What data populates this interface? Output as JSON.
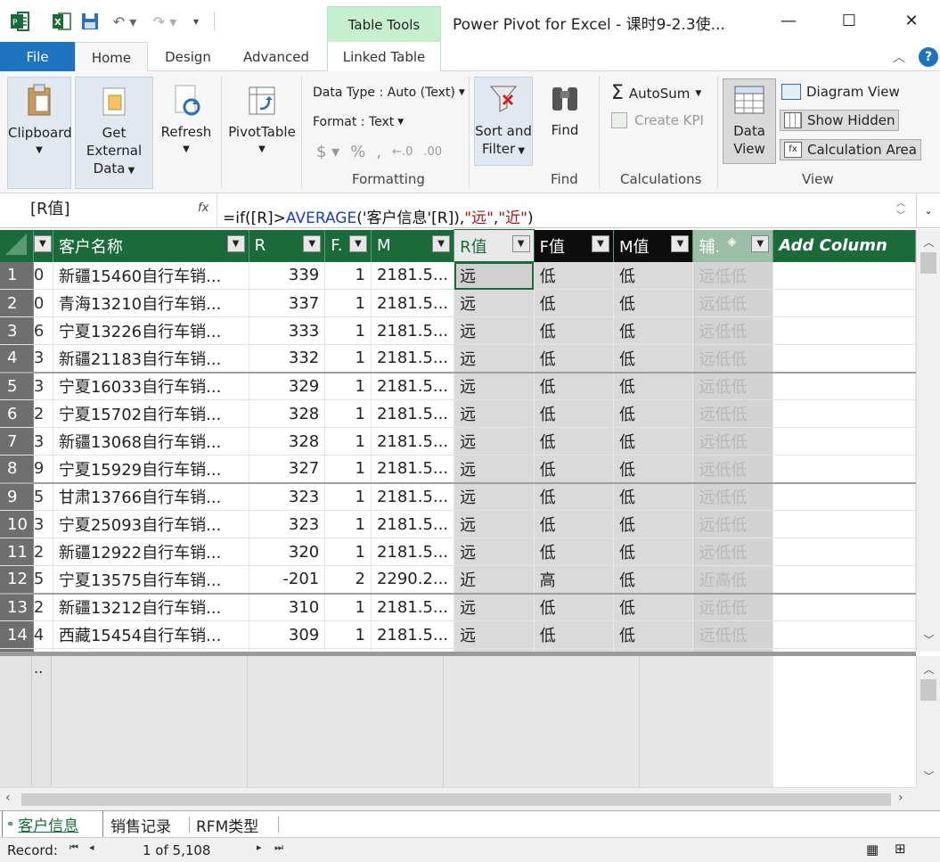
{
  "titlebar": {
    "table_tools": "Table Tools",
    "title": "Power Pivot for Excel - 课时9-2.3使..."
  },
  "tabs": [
    "File",
    "Home",
    "Design",
    "Advanced",
    "Linked Table"
  ],
  "ribbon": {
    "clipboard": "Clipboard",
    "get_external_data_1": "Get External",
    "get_external_data_2": "Data",
    "refresh": "Refresh",
    "pivottable": "PivotTable",
    "data_type": "Data Type : Auto (Text)",
    "format": "Format : Text",
    "formatting_label": "Formatting",
    "sort_filter_1": "Sort and",
    "sort_filter_2": "Filter",
    "find": "Find",
    "find_label": "Find",
    "autosum": "AutoSum",
    "create_kpi": "Create KPI",
    "calculations_label": "Calculations",
    "data_view_1": "Data",
    "data_view_2": "View",
    "diagram_view": "Diagram View",
    "show_hidden": "Show Hidden",
    "calculation_area": "Calculation Area",
    "view_label": "View"
  },
  "formula_bar": {
    "name_box": "[R值]",
    "fx": "fx",
    "formula_parts": [
      "=if([R]>",
      "AVERAGE",
      "('客户信息'[R]),",
      "\"远\"",
      ",",
      "\"近\"",
      ")"
    ]
  },
  "grid": {
    "headers": [
      "",
      "客户名称",
      "R",
      "F.",
      "M",
      "R值",
      "F值",
      "M值",
      "辅.",
      "Add Column"
    ],
    "rows": [
      {
        "n": "1",
        "i": "0",
        "name": "新疆15460自行车销...",
        "r": "339",
        "f": "1",
        "m": "2181.5...",
        "rv": "远",
        "fv": "低",
        "mv": "低",
        "h": "远低低"
      },
      {
        "n": "2",
        "i": "0",
        "name": "青海13210自行车销...",
        "r": "337",
        "f": "1",
        "m": "2181.5...",
        "rv": "远",
        "fv": "低",
        "mv": "低",
        "h": "远低低"
      },
      {
        "n": "3",
        "i": "6",
        "name": "宁夏13226自行车销...",
        "r": "333",
        "f": "1",
        "m": "2181.5...",
        "rv": "远",
        "fv": "低",
        "mv": "低",
        "h": "远低低"
      },
      {
        "n": "4",
        "i": "3",
        "name": "新疆21183自行车销...",
        "r": "332",
        "f": "1",
        "m": "2181.5...",
        "rv": "远",
        "fv": "低",
        "mv": "低",
        "h": "远低低"
      },
      {
        "n": "5",
        "i": "3",
        "name": "宁夏16033自行车销...",
        "r": "329",
        "f": "1",
        "m": "2181.5...",
        "rv": "远",
        "fv": "低",
        "mv": "低",
        "h": "远低低"
      },
      {
        "n": "6",
        "i": "2",
        "name": "宁夏15702自行车销...",
        "r": "328",
        "f": "1",
        "m": "2181.5...",
        "rv": "远",
        "fv": "低",
        "mv": "低",
        "h": "远低低"
      },
      {
        "n": "7",
        "i": "3",
        "name": "新疆13068自行车销...",
        "r": "328",
        "f": "1",
        "m": "2181.5...",
        "rv": "远",
        "fv": "低",
        "mv": "低",
        "h": "远低低"
      },
      {
        "n": "8",
        "i": "9",
        "name": "宁夏15929自行车销...",
        "r": "327",
        "f": "1",
        "m": "2181.5...",
        "rv": "远",
        "fv": "低",
        "mv": "低",
        "h": "远低低"
      },
      {
        "n": "9",
        "i": "5",
        "name": "甘肃13766自行车销...",
        "r": "323",
        "f": "1",
        "m": "2181.5...",
        "rv": "远",
        "fv": "低",
        "mv": "低",
        "h": "远低低"
      },
      {
        "n": "10",
        "i": "3",
        "name": "宁夏25093自行车销...",
        "r": "323",
        "f": "1",
        "m": "2181.5...",
        "rv": "远",
        "fv": "低",
        "mv": "低",
        "h": "远低低"
      },
      {
        "n": "11",
        "i": "2",
        "name": "新疆12922自行车销...",
        "r": "320",
        "f": "1",
        "m": "2181.5...",
        "rv": "远",
        "fv": "低",
        "mv": "低",
        "h": "远低低"
      },
      {
        "n": "12",
        "i": "5",
        "name": "宁夏13575自行车销...",
        "r": "-201",
        "f": "2",
        "m": "2290.2...",
        "rv": "近",
        "fv": "高",
        "mv": "低",
        "h": "近高低"
      },
      {
        "n": "13",
        "i": "2",
        "name": "新疆13212自行车销...",
        "r": "310",
        "f": "1",
        "m": "2181.5...",
        "rv": "远",
        "fv": "低",
        "mv": "低",
        "h": "远低低"
      },
      {
        "n": "14",
        "i": "4",
        "name": "西藏15454自行车销...",
        "r": "309",
        "f": "1",
        "m": "2181.5...",
        "rv": "远",
        "fv": "低",
        "mv": "低",
        "h": "远低低"
      }
    ]
  },
  "lower_pane": {
    "marker": ".."
  },
  "sheet_tabs": [
    "客户信息",
    "销售记录",
    "RFM类型"
  ],
  "status": {
    "record_label": "Record:",
    "record_value": "1 of 5,108"
  },
  "colors": {
    "accent_green": "#1b6b3a",
    "file_blue": "#1e73be",
    "table_tools_green": "#c6efce"
  }
}
